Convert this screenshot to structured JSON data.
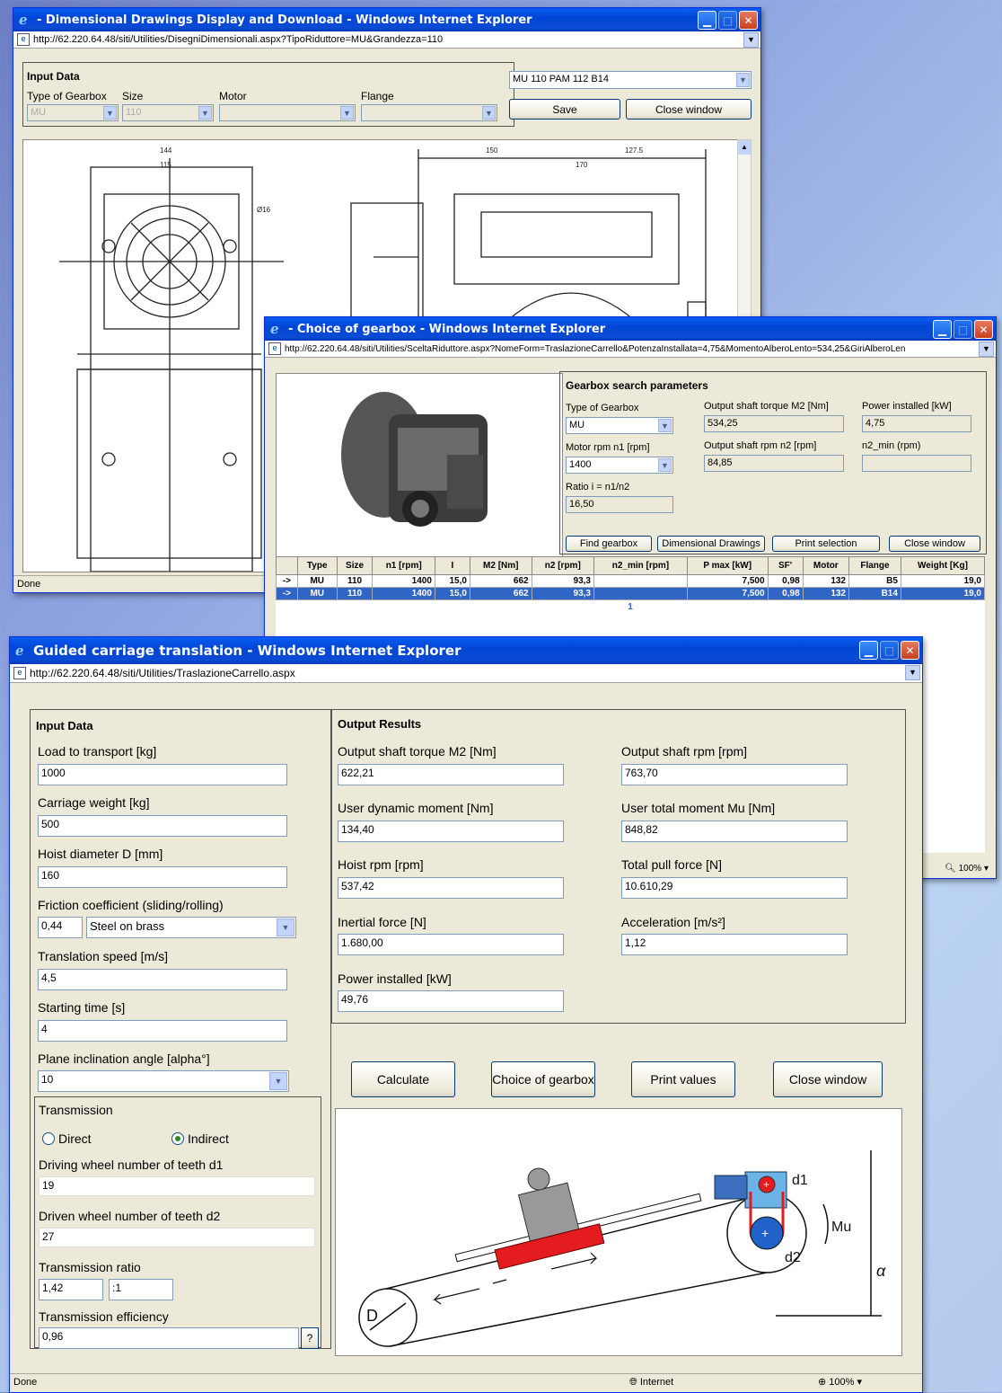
{
  "win1": {
    "title": "- Dimensional Drawings Display and Download - Windows Internet Explorer",
    "url": "http://62.220.64.48/siti/Utilities/DisegniDimensionali.aspx?TipoRiduttore=MU&Grandezza=110",
    "input_legend": "Input Data",
    "labels": {
      "type": "Type of Gearbox",
      "size": "Size",
      "motor": "Motor",
      "flange": "Flange"
    },
    "values": {
      "type": "MU",
      "size": "110",
      "motor": "",
      "flange": ""
    },
    "drawing_select": "MU 110 PAM 112 B14",
    "save": "Save",
    "close": "Close window",
    "status": "Done",
    "dims": {
      "d1": "144",
      "d2": "115",
      "d3": "150",
      "d4": "170",
      "d5": "Ø16",
      "d6": "127.5"
    }
  },
  "win2": {
    "title": "- Choice of gearbox - Windows Internet Explorer",
    "url": "http://62.220.64.48/siti/Utilities/SceltaRiduttore.aspx?NomeForm=TraslazioneCarrello&PotenzaInstallata=4,75&MomentoAlberoLento=534,25&GiriAlberoLen",
    "params_title": "Gearbox search parameters",
    "labels": {
      "type": "Type of Gearbox",
      "torque": "Output shaft torque M2 [Nm]",
      "power": "Power installed [kW]",
      "n1": "Motor rpm n1 [rpm]",
      "n2": "Output shaft rpm n2 [rpm]",
      "n2min": "n2_min (rpm)",
      "ratio": "Ratio i = n1/n2"
    },
    "values": {
      "type": "MU",
      "torque": "534,25",
      "power": "4,75",
      "n1": "1400",
      "n2": "84,85",
      "n2min": "",
      "ratio": "16,50"
    },
    "buttons": {
      "find": "Find gearbox",
      "dims": "Dimensional Drawings",
      "print": "Print selection",
      "close": "Close window"
    },
    "table": {
      "headers": [
        "",
        "Type",
        "Size",
        "n1 [rpm]",
        "I",
        "M2 [Nm]",
        "n2 [rpm]",
        "n2_min [rpm]",
        "P max [kW]",
        "SF'",
        "Motor",
        "Flange",
        "Weight [Kg]"
      ],
      "rows": [
        [
          "->",
          "MU",
          "110",
          "1400",
          "15,0",
          "662",
          "93,3",
          "",
          "7,500",
          "0,98",
          "132",
          "B5",
          "19,0"
        ],
        [
          "->",
          "MU",
          "110",
          "1400",
          "15,0",
          "662",
          "93,3",
          "",
          "7,500",
          "0,98",
          "132",
          "B14",
          "19,0"
        ]
      ],
      "pager": "1"
    },
    "zoom": "100%"
  },
  "win3": {
    "title": "Guided carriage translation - Windows Internet Explorer",
    "url": "http://62.220.64.48/siti/Utilities/TraslazioneCarrello.aspx",
    "input": {
      "title": "Input Data",
      "load_label": "Load to transport [kg]",
      "load": "1000",
      "carriage_label": "Carriage weight [kg]",
      "carriage": "500",
      "hoist_label": "Hoist diameter D [mm]",
      "hoist": "160",
      "friction_label": "Friction coefficient (sliding/rolling)",
      "friction": "0,44",
      "friction_material": "Steel on brass",
      "speed_label": "Translation speed [m/s]",
      "speed": "4,5",
      "start_label": "Starting time [s]",
      "start": "4",
      "angle_label": "Plane inclination angle [alpha°]",
      "angle": "10"
    },
    "transmission": {
      "title": "Transmission",
      "direct": "Direct",
      "indirect": "Indirect",
      "d1_label": "Driving wheel number of teeth d1",
      "d1": "19",
      "d2_label": "Driven wheel number of teeth d2",
      "d2": "27",
      "ratio_label": "Transmission ratio",
      "ratio": "1,42",
      "ratio_suffix": ":1",
      "eff_label": "Transmission efficiency",
      "eff": "0,96",
      "help": "?"
    },
    "output": {
      "title": "Output Results",
      "torque_label": "Output shaft torque M2 [Nm]",
      "torque": "622,21",
      "rpm_label": "Output shaft rpm [rpm]",
      "rpm": "763,70",
      "dyn_label": "User dynamic moment [Nm]",
      "dyn": "134,40",
      "total_label": "User total moment Mu [Nm]",
      "total": "848,82",
      "hoistrpm_label": "Hoist rpm [rpm]",
      "hoistrpm": "537,42",
      "pull_label": "Total pull force [N]",
      "pull": "10.610,29",
      "inertial_label": "Inertial force [N]",
      "inertial": "1.680,00",
      "accel_label": "Acceleration [m/s²]",
      "accel": "1,12",
      "power_label": "Power installed [kW]",
      "power": "49,76"
    },
    "buttons": {
      "calc": "Calculate",
      "choice": "Choice of gearbox",
      "print": "Print values",
      "close": "Close window"
    },
    "diagram": {
      "d1": "d1",
      "d2": "d2",
      "mu": "Mu",
      "D": "D",
      "alpha": "α"
    },
    "status": {
      "done": "Done",
      "zone": "Internet",
      "zoom": "100%"
    }
  }
}
